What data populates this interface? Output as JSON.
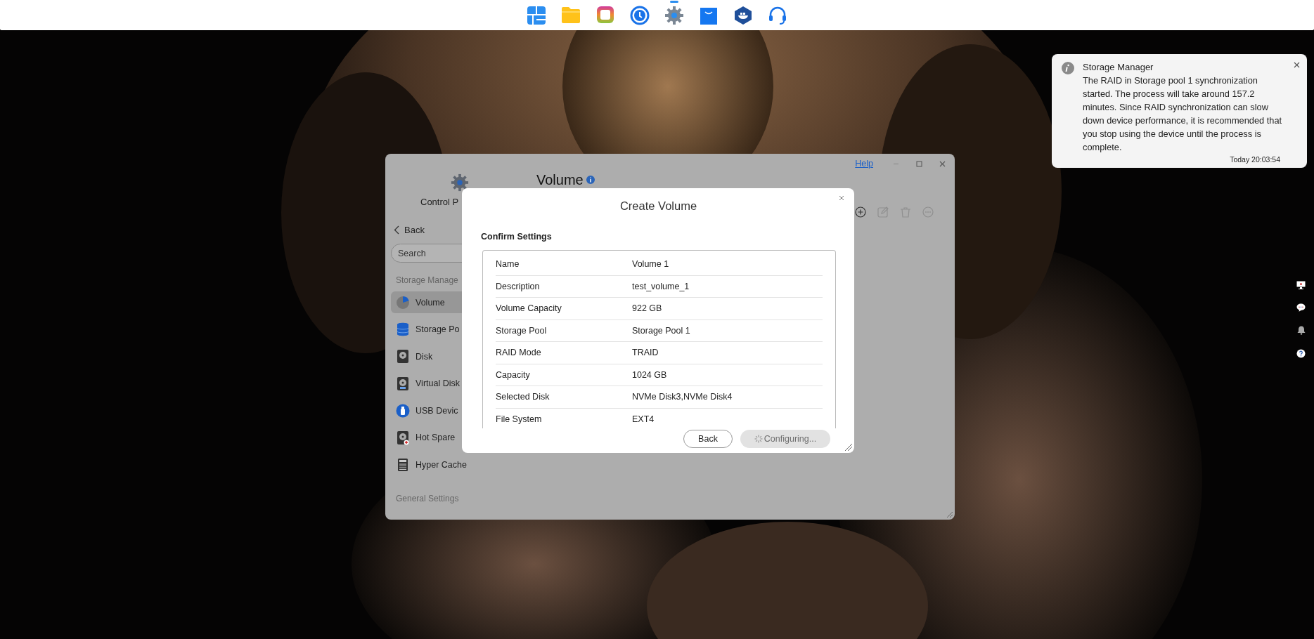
{
  "dock": [
    {
      "kind": "tiles",
      "running": false
    },
    {
      "kind": "folder",
      "running": false
    },
    {
      "kind": "photos",
      "running": false
    },
    {
      "kind": "clock",
      "running": false
    },
    {
      "kind": "gear",
      "running": true
    },
    {
      "kind": "bag",
      "running": false
    },
    {
      "kind": "whale",
      "running": false
    },
    {
      "kind": "headset",
      "running": false
    }
  ],
  "notification": {
    "title": "Storage Manager",
    "message": "The RAID in Storage pool 1 synchronization started. The process will take around 157.2 minutes. Since RAID synchronization can slow down device performance, it is recommended that you stop using the device until the process is complete.",
    "time": "Today 20:03:54"
  },
  "side_icons": [
    {
      "kind": "monitor"
    },
    {
      "kind": "chat"
    },
    {
      "kind": "bell"
    },
    {
      "kind": "help"
    }
  ],
  "window": {
    "help_link": "Help",
    "app_label": "Control P",
    "title": "Volume",
    "back": "Back",
    "search": {
      "placeholder": "Search"
    },
    "sections": [
      {
        "heading": "Storage Manage",
        "items": [
          {
            "label": "Volume",
            "kind": "volume",
            "selected": true
          },
          {
            "label": "Storage Po",
            "kind": "pool",
            "selected": false
          },
          {
            "label": "Disk",
            "kind": "disk",
            "selected": false
          },
          {
            "label": "Virtual Disk",
            "kind": "virtual-disk",
            "selected": false
          },
          {
            "label": "USB Devic",
            "kind": "usb",
            "selected": false
          },
          {
            "label": "Hot Spare",
            "kind": "hot-spare",
            "selected": false
          },
          {
            "label": "Hyper Cache",
            "kind": "cache",
            "selected": false
          }
        ]
      },
      {
        "heading": "General Settings"
      }
    ],
    "toolbar": [
      {
        "kind": "add",
        "disabled": false
      },
      {
        "kind": "edit",
        "disabled": true
      },
      {
        "kind": "delete",
        "disabled": true
      },
      {
        "kind": "more",
        "disabled": true
      }
    ]
  },
  "dialog": {
    "title": "Create Volume",
    "section": "Confirm Settings",
    "rows": [
      {
        "label": "Name",
        "value": "Volume 1"
      },
      {
        "label": "Description",
        "value": "test_volume_1"
      },
      {
        "label": "Volume Capacity",
        "value": "922 GB"
      },
      {
        "label": "Storage Pool",
        "value": "Storage Pool 1"
      },
      {
        "label": "RAID Mode",
        "value": "TRAID"
      },
      {
        "label": "Capacity",
        "value": "1024 GB"
      },
      {
        "label": "Selected Disk",
        "value": "NVMe Disk3,NVMe Disk4"
      },
      {
        "label": "File System",
        "value": "EXT4"
      }
    ],
    "buttons": [
      {
        "label": "Back",
        "kind": "secondary",
        "disabled": false
      },
      {
        "label": "Configuring...",
        "kind": "busy",
        "disabled": true
      }
    ]
  }
}
